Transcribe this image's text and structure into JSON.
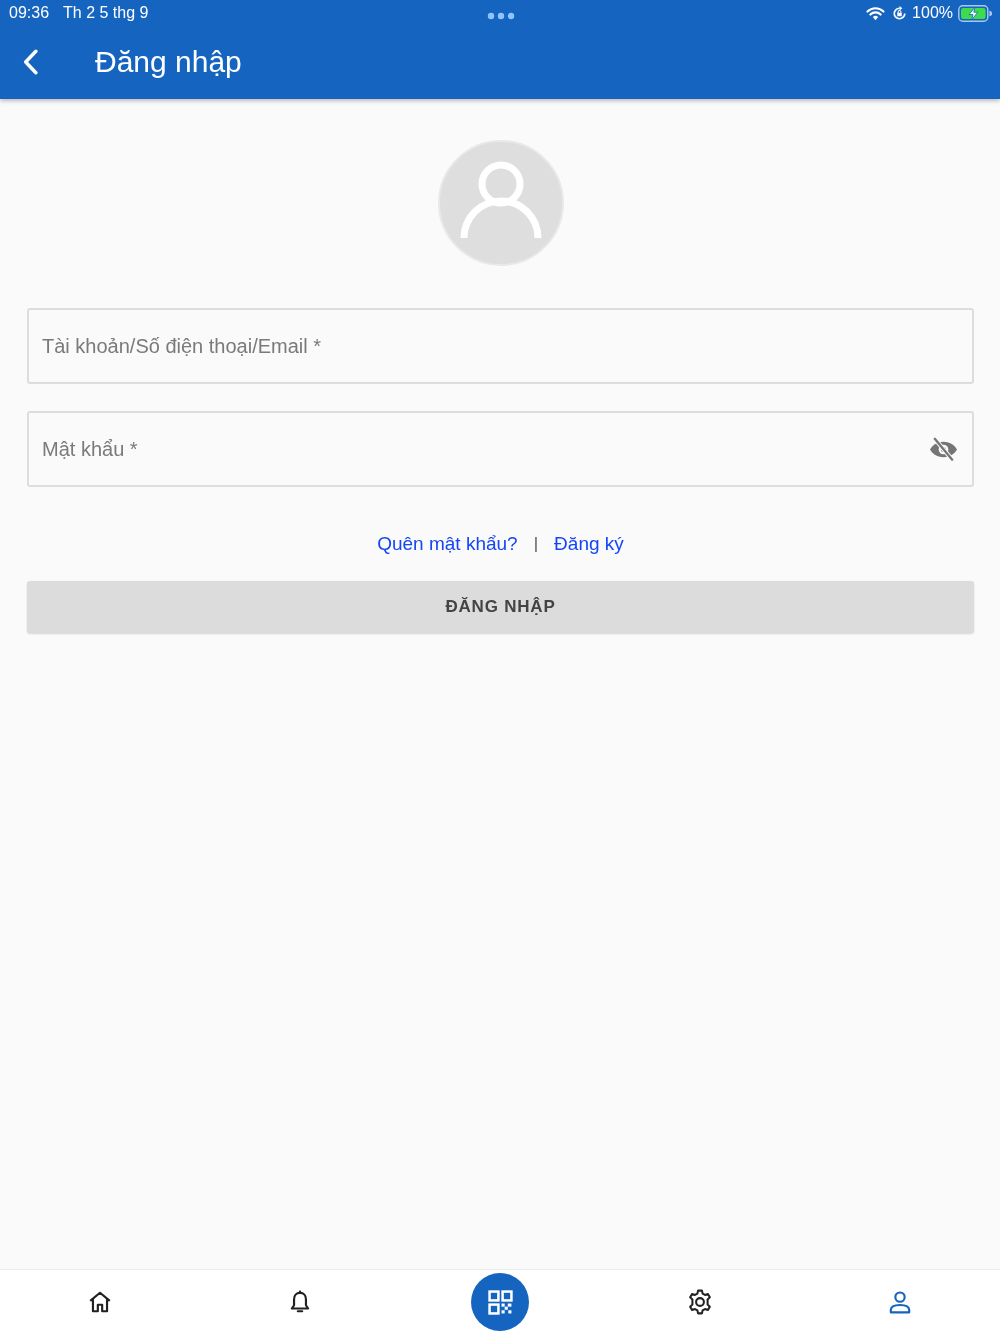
{
  "status_bar": {
    "time": "09:36",
    "date": "Th 2 5 thg 9",
    "battery": "100%"
  },
  "app_bar": {
    "title": "Đăng nhập"
  },
  "form": {
    "username": {
      "placeholder": "Tài khoản/Số điện thoại/Email *"
    },
    "password": {
      "placeholder": "Mật khẩu *",
      "obscured": true
    }
  },
  "links": {
    "items": [
      {
        "label": "Quên mật khẩu?"
      },
      {
        "label": "Đăng ký"
      }
    ],
    "separator": "|"
  },
  "login_button": {
    "label": "ĐĂNG NHẬP",
    "disabled": true
  },
  "bottom_nav": [
    {
      "kind": "home",
      "selected": false
    },
    {
      "kind": "notifications",
      "selected": false
    },
    {
      "kind": "scan",
      "selected": false
    },
    {
      "kind": "settings",
      "selected": false
    },
    {
      "kind": "profile",
      "selected": true
    }
  ]
}
